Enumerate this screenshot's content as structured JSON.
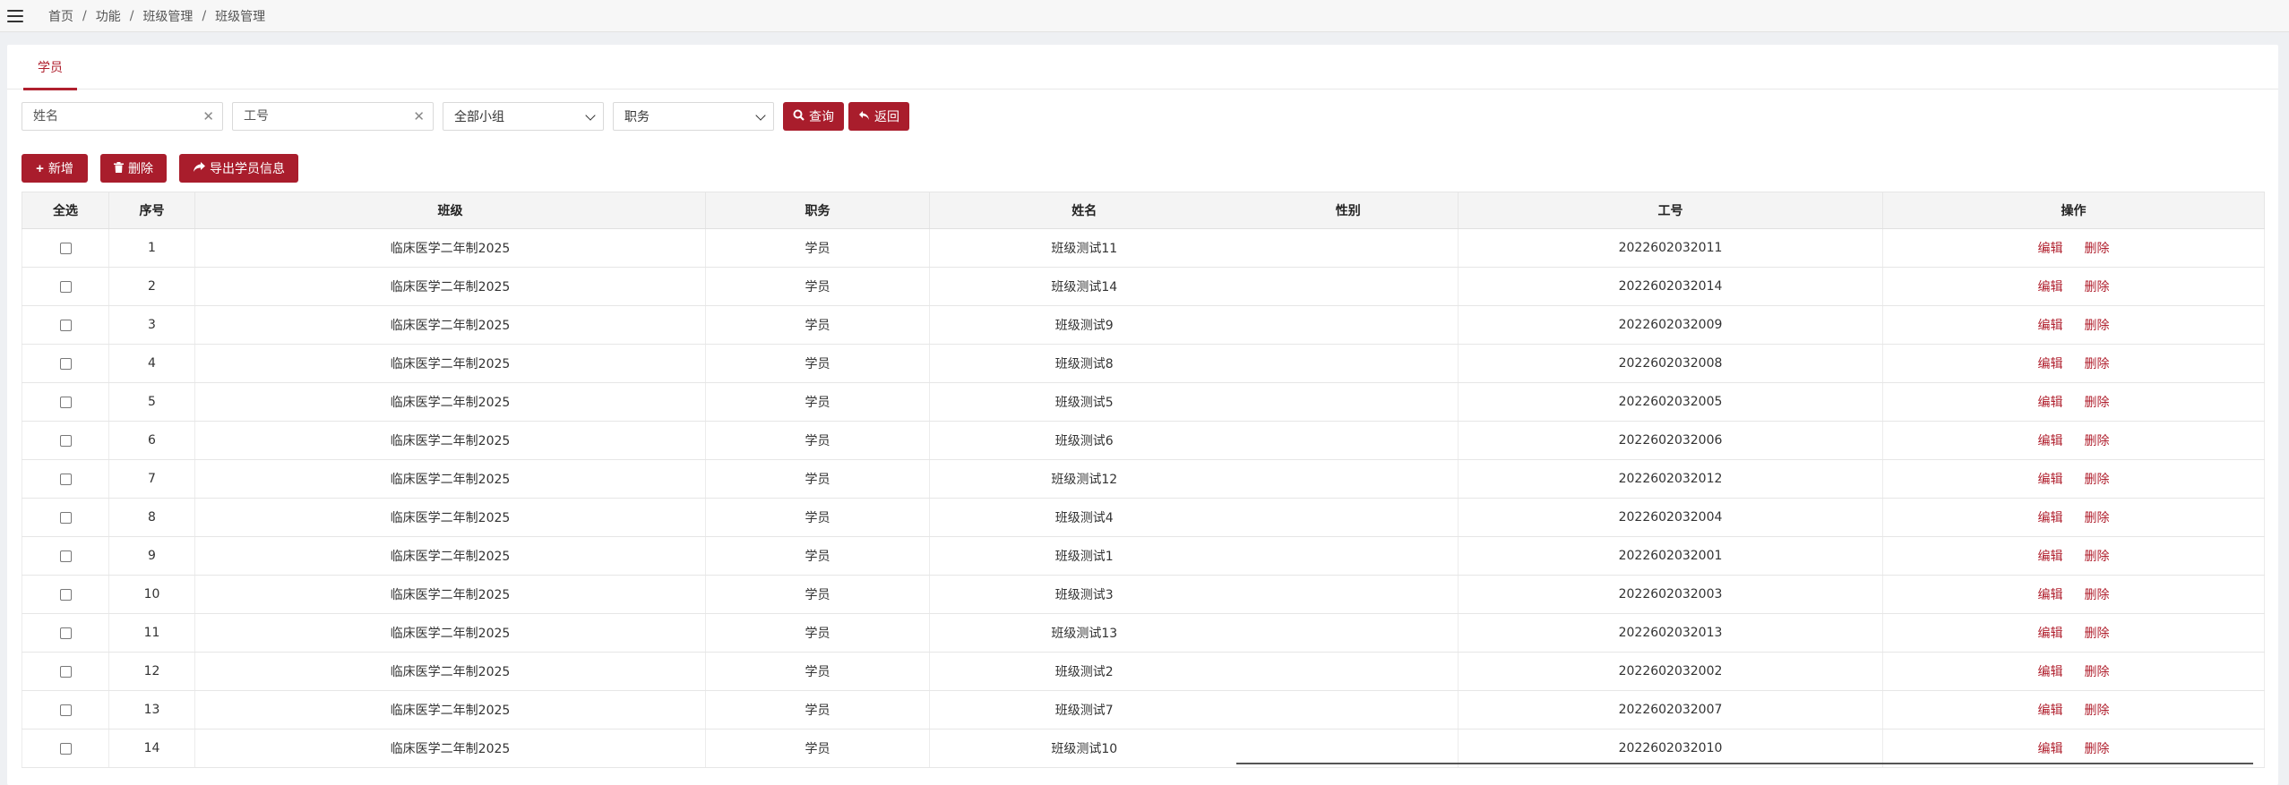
{
  "breadcrumb": [
    "首页",
    "功能",
    "班级管理",
    "班级管理"
  ],
  "tab": "学员",
  "search": {
    "name_placeholder": "姓名",
    "id_placeholder": "工号",
    "group_selected": "全部小组",
    "role_selected": "职务",
    "query_label": "查询",
    "back_label": "返回"
  },
  "actions": {
    "add_label": "新增",
    "delete_label": "删除",
    "export_label": "导出学员信息"
  },
  "table": {
    "headers": [
      "全选",
      "序号",
      "班级",
      "职务",
      "姓名",
      "性别",
      "工号",
      "操作"
    ],
    "edit_label": "编辑",
    "delete_label": "删除",
    "rows": [
      {
        "no": "1",
        "class": "临床医学二年制2025",
        "role": "学员",
        "name": "班级测试11",
        "gender": "",
        "id": "2022602032011"
      },
      {
        "no": "2",
        "class": "临床医学二年制2025",
        "role": "学员",
        "name": "班级测试14",
        "gender": "",
        "id": "2022602032014"
      },
      {
        "no": "3",
        "class": "临床医学二年制2025",
        "role": "学员",
        "name": "班级测试9",
        "gender": "",
        "id": "2022602032009"
      },
      {
        "no": "4",
        "class": "临床医学二年制2025",
        "role": "学员",
        "name": "班级测试8",
        "gender": "",
        "id": "2022602032008"
      },
      {
        "no": "5",
        "class": "临床医学二年制2025",
        "role": "学员",
        "name": "班级测试5",
        "gender": "",
        "id": "2022602032005"
      },
      {
        "no": "6",
        "class": "临床医学二年制2025",
        "role": "学员",
        "name": "班级测试6",
        "gender": "",
        "id": "2022602032006"
      },
      {
        "no": "7",
        "class": "临床医学二年制2025",
        "role": "学员",
        "name": "班级测试12",
        "gender": "",
        "id": "2022602032012"
      },
      {
        "no": "8",
        "class": "临床医学二年制2025",
        "role": "学员",
        "name": "班级测试4",
        "gender": "",
        "id": "2022602032004"
      },
      {
        "no": "9",
        "class": "临床医学二年制2025",
        "role": "学员",
        "name": "班级测试1",
        "gender": "",
        "id": "2022602032001"
      },
      {
        "no": "10",
        "class": "临床医学二年制2025",
        "role": "学员",
        "name": "班级测试3",
        "gender": "",
        "id": "2022602032003"
      },
      {
        "no": "11",
        "class": "临床医学二年制2025",
        "role": "学员",
        "name": "班级测试13",
        "gender": "",
        "id": "2022602032013"
      },
      {
        "no": "12",
        "class": "临床医学二年制2025",
        "role": "学员",
        "name": "班级测试2",
        "gender": "",
        "id": "2022602032002"
      },
      {
        "no": "13",
        "class": "临床医学二年制2025",
        "role": "学员",
        "name": "班级测试7",
        "gender": "",
        "id": "2022602032007"
      },
      {
        "no": "14",
        "class": "临床医学二年制2025",
        "role": "学员",
        "name": "班级测试10",
        "gender": "",
        "id": "2022602032010"
      }
    ]
  },
  "colors": {
    "accent": "#a91d2c",
    "link": "#b0202e"
  },
  "icons": {
    "menu": "hamburger-icon",
    "clear": "close-icon",
    "query": "search-icon",
    "back": "reply-icon",
    "add": "plus-icon",
    "delete": "trash-icon",
    "export": "share-icon"
  }
}
